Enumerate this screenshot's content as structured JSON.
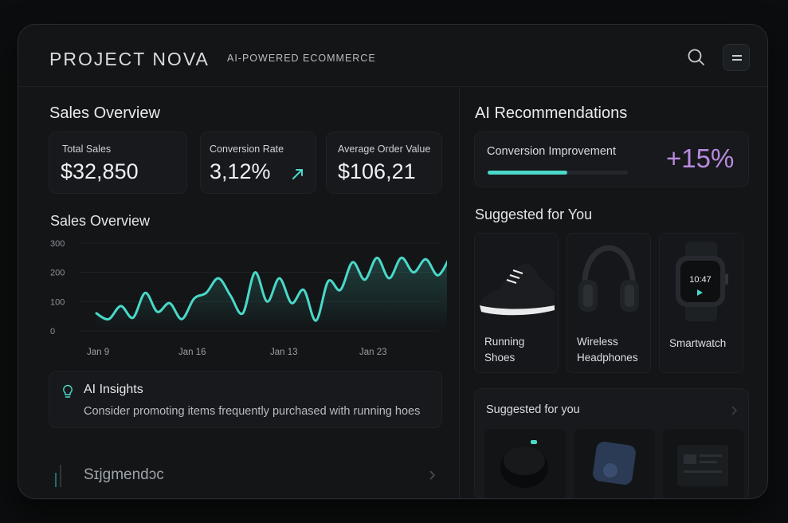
{
  "header": {
    "brand": "PROJECT NOVA",
    "tagline": "AI-POWERED ECOMMERCE",
    "search_icon": "search-icon",
    "menu_icon": "menu-icon"
  },
  "left": {
    "title": "Sales Overview",
    "kpis": [
      {
        "label": "Total Sales",
        "value": "$32,850"
      },
      {
        "label": "Conversion Rate",
        "value": "3,12%",
        "trend_icon": "trend-up-arrow-icon"
      },
      {
        "label": "Average Order Value",
        "value": "$106,21"
      }
    ],
    "chart_title": "Sales Overview",
    "insights": {
      "icon": "lightbulb-icon",
      "title": "AI Insights",
      "text": "Consider promoting items frequently purchased with running hoes"
    },
    "segment": {
      "label": "Sɪjgmendɔc",
      "chevron": "chevron-right-icon"
    }
  },
  "right": {
    "title": "AI Recommendations",
    "recommendation": {
      "label": "Conversion Improvement",
      "value": "+15%",
      "progress": 0.57
    },
    "suggested_title": "Suggested for You",
    "products": [
      {
        "name_line1": "Running",
        "name_line2": "Shoes",
        "icon": "running-shoe-icon"
      },
      {
        "name_line1": "Wireless",
        "name_line2": "Headphones",
        "icon": "headphones-icon"
      },
      {
        "name_line1": "Smartwatch",
        "name_line2": "",
        "icon": "smartwatch-icon",
        "watch_time": "10:47"
      }
    ],
    "suggested_small_title": "Suggested for you"
  },
  "colors": {
    "accent": "#4ad8c8",
    "purple": "#b98ae0",
    "background": "#131517"
  },
  "chart_data": {
    "type": "area",
    "title": "Sales Overview",
    "x_tick_labels": [
      "Jan 9",
      "Jan 16",
      "Jan 13",
      "Jan 23"
    ],
    "y_tick_labels": [
      "0",
      "100",
      "200",
      "300"
    ],
    "ylim": [
      0,
      300
    ],
    "grid": true,
    "series": [
      {
        "values": [
          60,
          40,
          85,
          45,
          130,
          65,
          95,
          40,
          110,
          130,
          180,
          120,
          60,
          200,
          100,
          180,
          95,
          140,
          35,
          170,
          140,
          235,
          175,
          250,
          180,
          250,
          200,
          245,
          190,
          255
        ]
      }
    ]
  }
}
